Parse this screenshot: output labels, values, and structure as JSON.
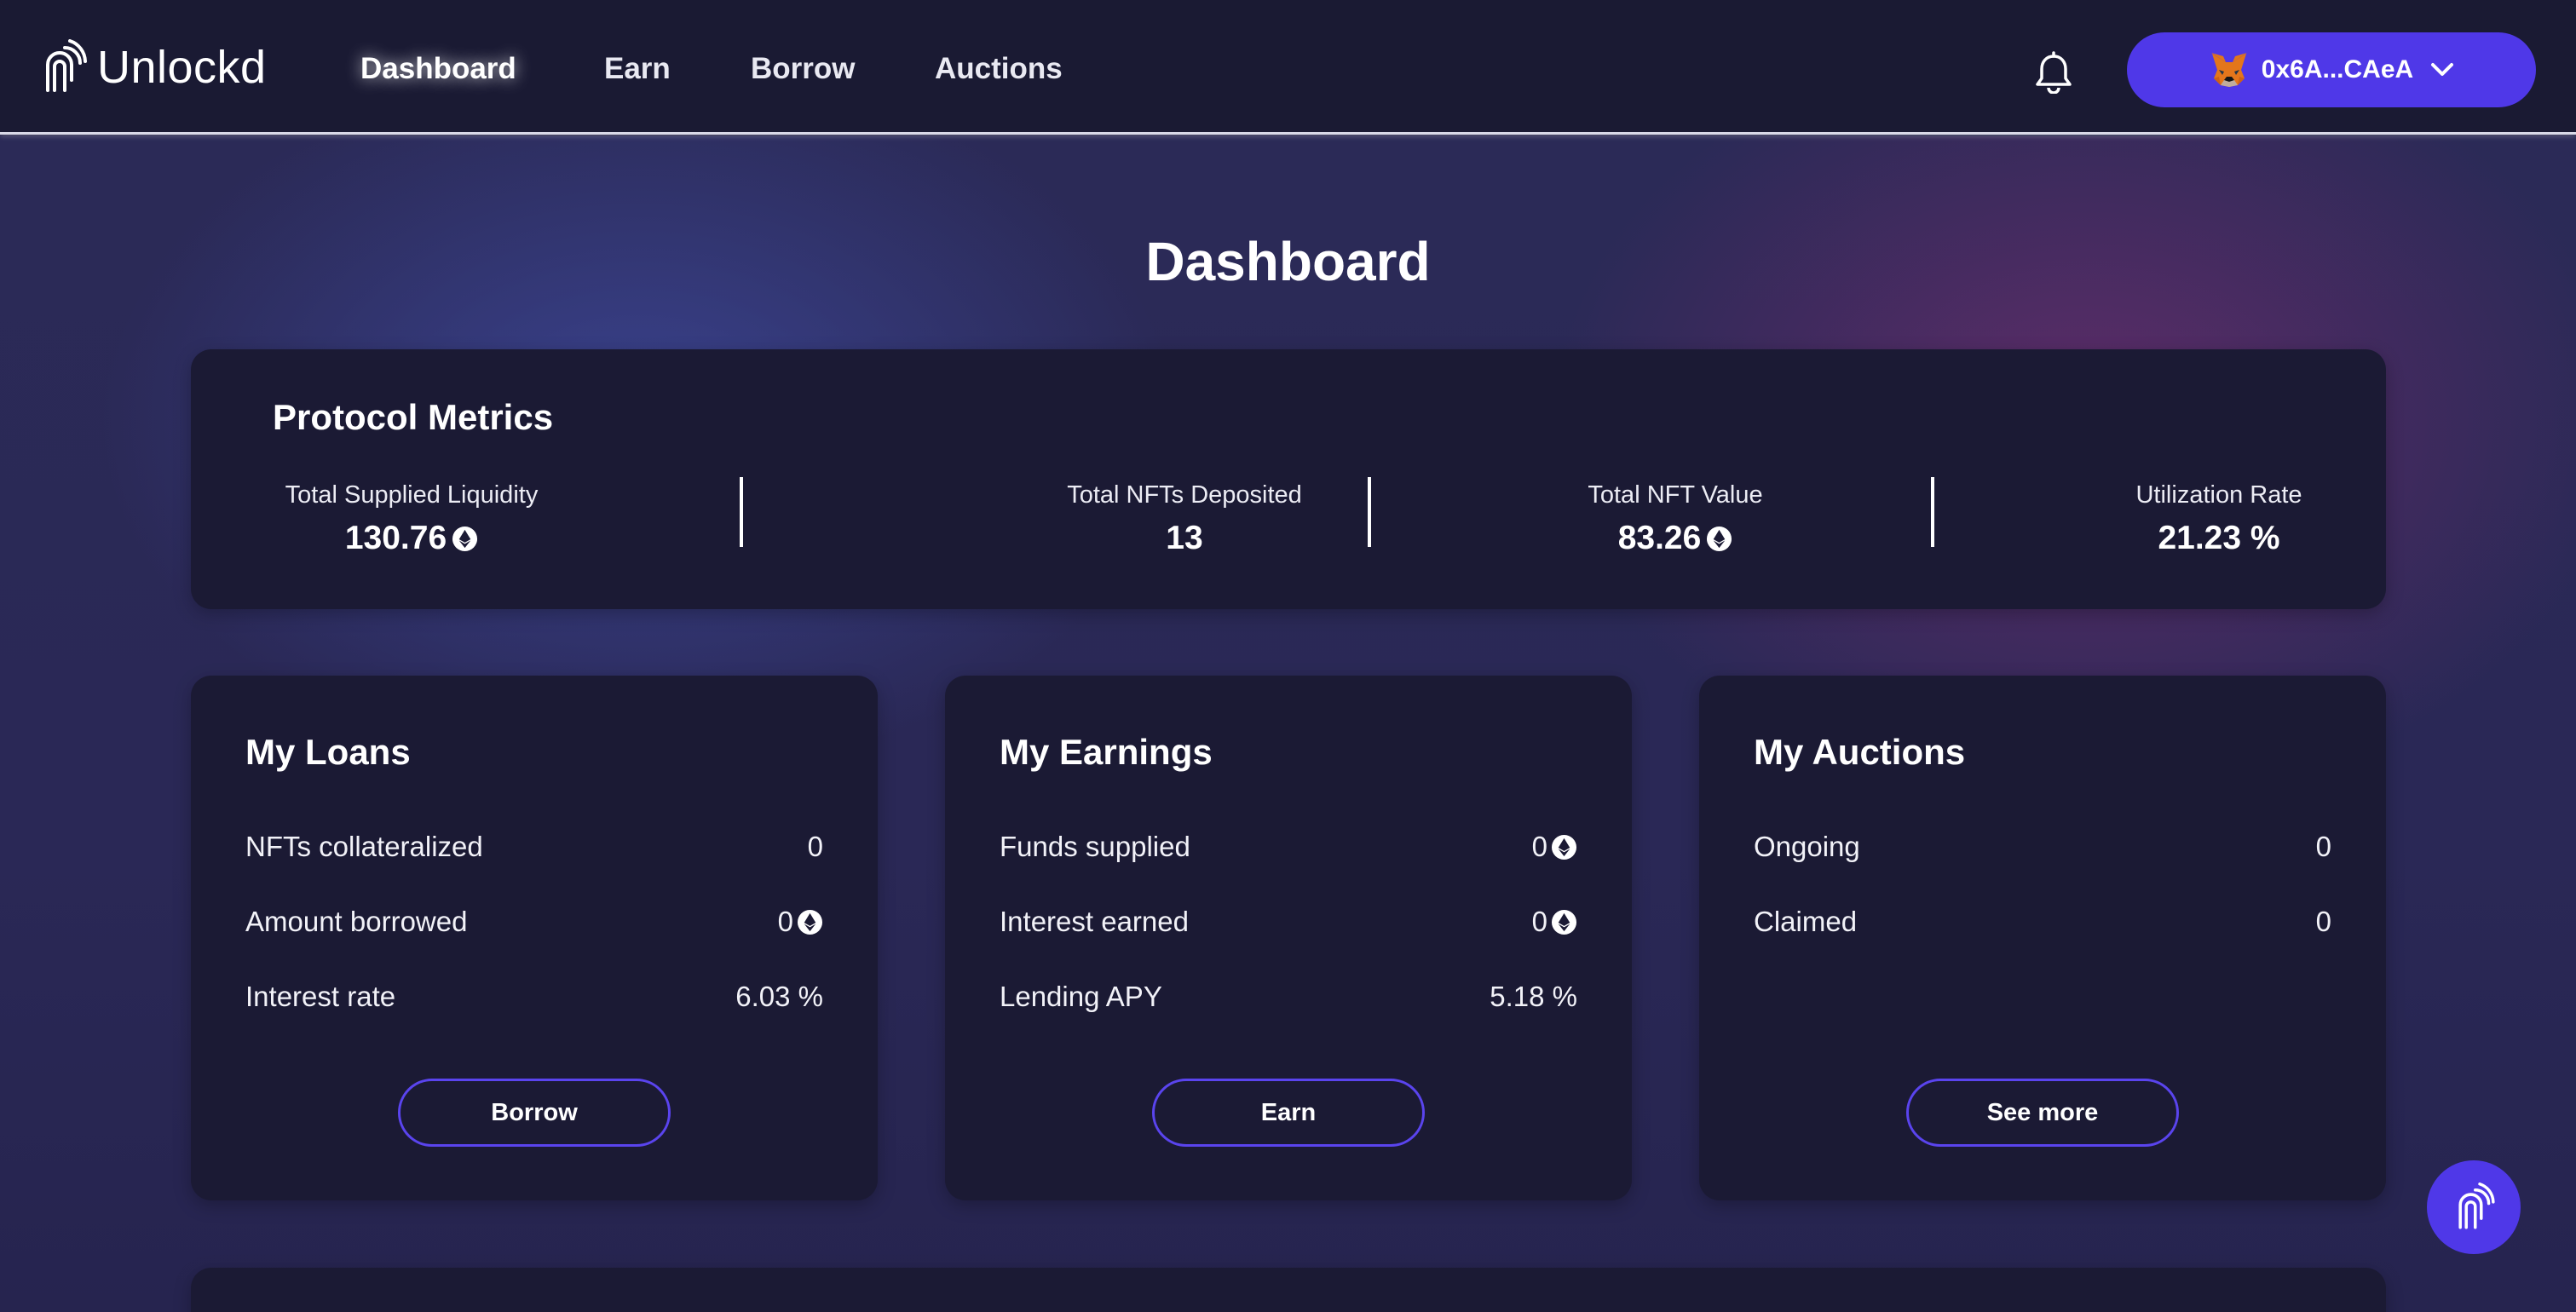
{
  "brand": {
    "name": "Unlockd"
  },
  "nav": {
    "links": [
      {
        "label": "Dashboard",
        "active": true
      },
      {
        "label": "Earn",
        "active": false
      },
      {
        "label": "Borrow",
        "active": false
      },
      {
        "label": "Auctions",
        "active": false
      }
    ],
    "wallet": {
      "address": "0x6A...CAeA"
    }
  },
  "page": {
    "title": "Dashboard"
  },
  "metrics": {
    "title": "Protocol Metrics",
    "items": [
      {
        "label": "Total Supplied Liquidity",
        "value": "130.76",
        "unit_icon": "eth-icon"
      },
      {
        "label": "Total NFTs Deposited",
        "value": "13"
      },
      {
        "label": "Total NFT Value",
        "value": "83.26",
        "unit_icon": "eth-icon"
      },
      {
        "label": "Utilization Rate",
        "value": "21.23 %"
      }
    ]
  },
  "loans": {
    "title": "My Loans",
    "rows": [
      {
        "label": "NFTs collateralized",
        "value": "0"
      },
      {
        "label": "Amount borrowed",
        "value": "0",
        "unit_icon": "eth-icon"
      },
      {
        "label": "Interest rate",
        "value": "6.03 %"
      }
    ],
    "button": "Borrow"
  },
  "earnings": {
    "title": "My Earnings",
    "rows": [
      {
        "label": "Funds supplied",
        "value": "0",
        "unit_icon": "eth-icon"
      },
      {
        "label": "Interest earned",
        "value": "0",
        "unit_icon": "eth-icon"
      },
      {
        "label": "Lending APY",
        "value": "5.18 %"
      }
    ],
    "button": "Earn"
  },
  "auctions": {
    "title": "My Auctions",
    "rows": [
      {
        "label": "Ongoing",
        "value": "0"
      },
      {
        "label": "Claimed",
        "value": "0"
      }
    ],
    "button": "See more"
  },
  "colors": {
    "accent": "#4f38e8",
    "navbar": "#1a1a33",
    "card": "#1b1a34",
    "background": "#2a2856"
  }
}
